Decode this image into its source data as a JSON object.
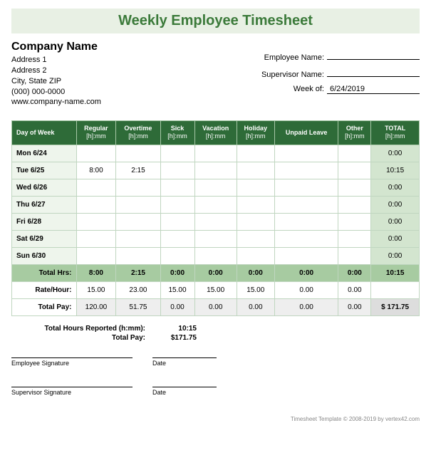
{
  "title": "Weekly Employee Timesheet",
  "company": {
    "name": "Company Name",
    "address1": "Address 1",
    "address2": "Address 2",
    "citystatezip": "City, State  ZIP",
    "phone": "(000) 000-0000",
    "website": "www.company-name.com"
  },
  "info": {
    "employee_label": "Employee Name:",
    "employee_value": "",
    "supervisor_label": "Supervisor Name:",
    "supervisor_value": "",
    "weekof_label": "Week of:",
    "weekof_value": "6/24/2019"
  },
  "columns": {
    "day": "Day of Week",
    "regular": "Regular",
    "overtime": "Overtime",
    "sick": "Sick",
    "vacation": "Vacation",
    "holiday": "Holiday",
    "unpaid": "Unpaid Leave",
    "other": "Other",
    "total": "TOTAL",
    "sub": "[h]:mm"
  },
  "rows": [
    {
      "day": "Mon 6/24",
      "regular": "",
      "overtime": "",
      "sick": "",
      "vacation": "",
      "holiday": "",
      "unpaid": "",
      "other": "",
      "total": "0:00"
    },
    {
      "day": "Tue 6/25",
      "regular": "8:00",
      "overtime": "2:15",
      "sick": "",
      "vacation": "",
      "holiday": "",
      "unpaid": "",
      "other": "",
      "total": "10:15"
    },
    {
      "day": "Wed 6/26",
      "regular": "",
      "overtime": "",
      "sick": "",
      "vacation": "",
      "holiday": "",
      "unpaid": "",
      "other": "",
      "total": "0:00"
    },
    {
      "day": "Thu 6/27",
      "regular": "",
      "overtime": "",
      "sick": "",
      "vacation": "",
      "holiday": "",
      "unpaid": "",
      "other": "",
      "total": "0:00"
    },
    {
      "day": "Fri 6/28",
      "regular": "",
      "overtime": "",
      "sick": "",
      "vacation": "",
      "holiday": "",
      "unpaid": "",
      "other": "",
      "total": "0:00"
    },
    {
      "day": "Sat 6/29",
      "regular": "",
      "overtime": "",
      "sick": "",
      "vacation": "",
      "holiday": "",
      "unpaid": "",
      "other": "",
      "total": "0:00"
    },
    {
      "day": "Sun 6/30",
      "regular": "",
      "overtime": "",
      "sick": "",
      "vacation": "",
      "holiday": "",
      "unpaid": "",
      "other": "",
      "total": "0:00"
    }
  ],
  "totals": {
    "label": "Total Hrs:",
    "regular": "8:00",
    "overtime": "2:15",
    "sick": "0:00",
    "vacation": "0:00",
    "holiday": "0:00",
    "unpaid": "0:00",
    "other": "0:00",
    "total": "10:15"
  },
  "rate": {
    "label": "Rate/Hour:",
    "regular": "15.00",
    "overtime": "23.00",
    "sick": "15.00",
    "vacation": "15.00",
    "holiday": "15.00",
    "unpaid": "0.00",
    "other": "0.00",
    "total": ""
  },
  "pay": {
    "label": "Total Pay:",
    "regular": "120.00",
    "overtime": "51.75",
    "sick": "0.00",
    "vacation": "0.00",
    "holiday": "0.00",
    "unpaid": "0.00",
    "other": "0.00",
    "total": "$   171.75"
  },
  "summary": {
    "hours_label": "Total Hours Reported (h:mm):",
    "hours_value": "10:15",
    "pay_label": "Total Pay:",
    "pay_value": "$171.75"
  },
  "signatures": {
    "employee": "Employee Signature",
    "supervisor": "Supervisor Signature",
    "date": "Date"
  },
  "footer": "Timesheet Template © 2008-2019 by vertex42.com"
}
